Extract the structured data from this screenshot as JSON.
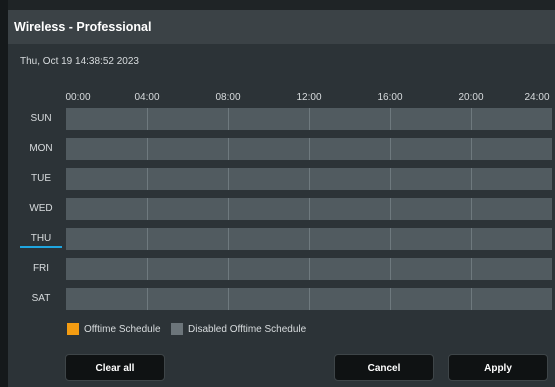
{
  "header": {
    "title": "Wireless - Professional"
  },
  "datetime": "Thu, Oct 19 14:38:52 2023",
  "hours": [
    "00:00",
    "04:00",
    "08:00",
    "12:00",
    "16:00",
    "20:00",
    "24:00"
  ],
  "days": [
    "SUN",
    "MON",
    "TUE",
    "WED",
    "THU",
    "FRI",
    "SAT"
  ],
  "today": "THU",
  "legend": {
    "offtime": {
      "label": "Offtime Schedule",
      "color": "#f39c12"
    },
    "disabled": {
      "label": "Disabled Offtime Schedule",
      "color": "#6c757a"
    }
  },
  "buttons": {
    "clear_all": "Clear all",
    "cancel": "Cancel",
    "apply": "Apply"
  }
}
